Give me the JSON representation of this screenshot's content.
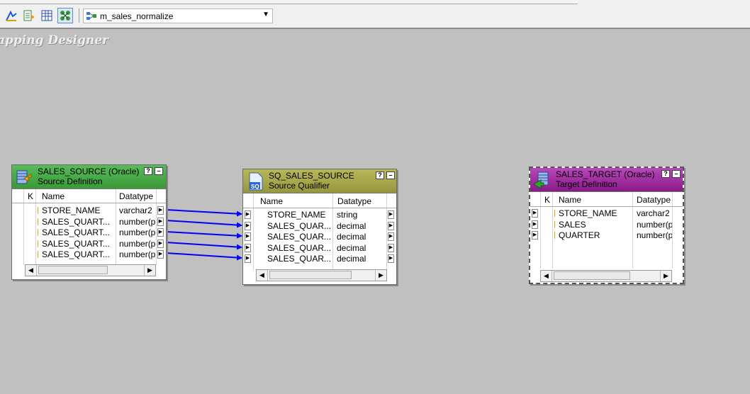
{
  "toolbar": {
    "mapping_name": "m_sales_normalize",
    "buttons": [
      "source-analyzer-icon",
      "target-designer-icon",
      "transformation-developer-icon",
      "mapping-designer-icon"
    ]
  },
  "designer_title": "apping Designer",
  "source": {
    "title": "SALES_SOURCE (Oracle)",
    "subtitle": "Source Definition",
    "col_key": "K",
    "col_name": "Name",
    "col_type": "Datatype",
    "help": "?",
    "minimize": "–",
    "rows": [
      {
        "name": "STORE_NAME",
        "type": "varchar2"
      },
      {
        "name": "SALES_QUART...",
        "type": "number(p"
      },
      {
        "name": "SALES_QUART...",
        "type": "number(p"
      },
      {
        "name": "SALES_QUART...",
        "type": "number(p"
      },
      {
        "name": "SALES_QUART...",
        "type": "number(p"
      }
    ],
    "header_color": "#4caf4c"
  },
  "qualifier": {
    "title": "SQ_SALES_SOURCE",
    "subtitle": "Source Qualifier",
    "icon_label": "SQ",
    "col_name": "Name",
    "col_type": "Datatype",
    "help": "?",
    "minimize": "–",
    "rows": [
      {
        "name": "STORE_NAME",
        "type": "string"
      },
      {
        "name": "SALES_QUAR...",
        "type": "decimal"
      },
      {
        "name": "SALES_QUAR...",
        "type": "decimal"
      },
      {
        "name": "SALES_QUAR...",
        "type": "decimal"
      },
      {
        "name": "SALES_QUAR...",
        "type": "decimal"
      }
    ],
    "header_color": "#a8a848"
  },
  "target": {
    "title": "SALES_TARGET (Oracle)",
    "subtitle": "Target Definition",
    "col_key": "K",
    "col_name": "Name",
    "col_type": "Datatype",
    "help": "?",
    "minimize": "–",
    "rows": [
      {
        "name": "STORE_NAME",
        "type": "varchar2"
      },
      {
        "name": "SALES",
        "type": "number(p"
      },
      {
        "name": "QUARTER",
        "type": "number(p"
      }
    ],
    "header_color": "#a030a0"
  },
  "link_color": "#0000ff"
}
